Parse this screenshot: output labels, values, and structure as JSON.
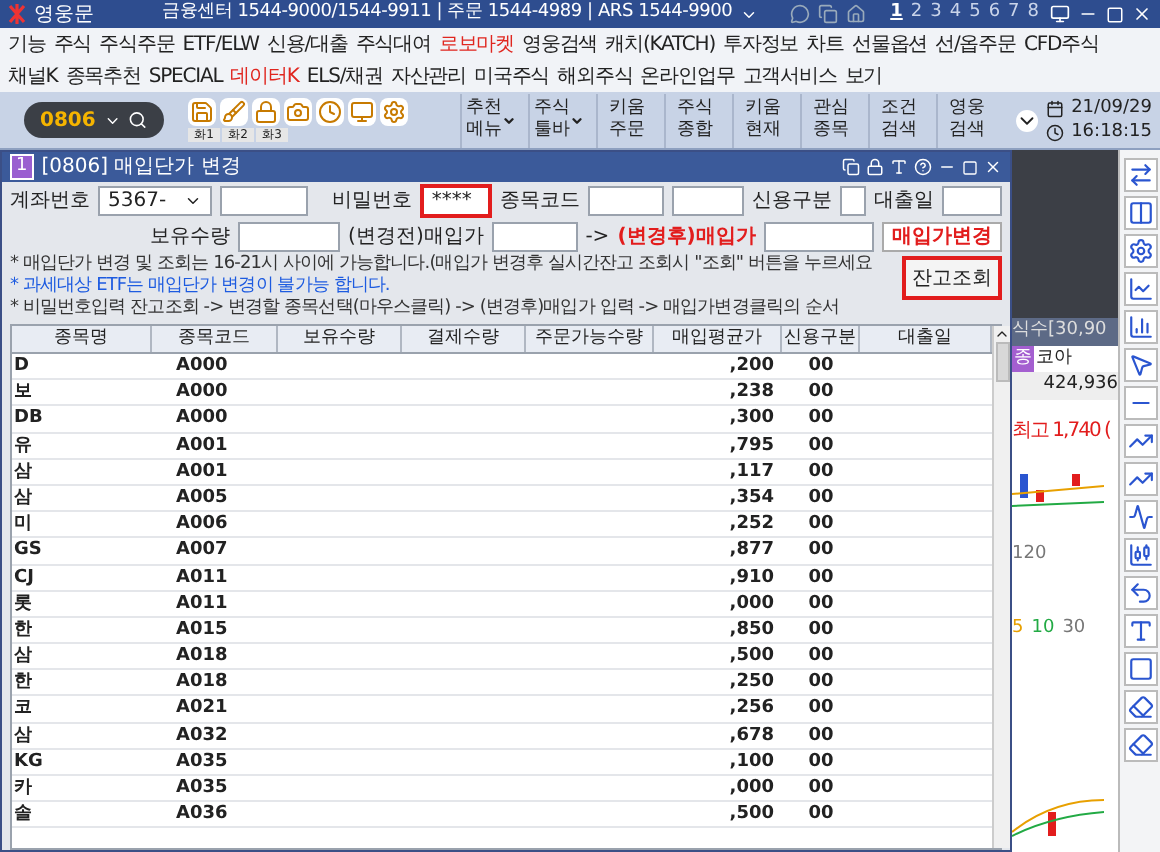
{
  "app": {
    "title": "영웅문",
    "contact": "금융센터 1544-9000/1544-9911 | 주문 1544-4989 | ARS 1544-9900",
    "pages": [
      {
        "label": "1",
        "selected": true
      },
      {
        "label": "2",
        "selected": false
      },
      {
        "label": "3",
        "selected": false
      },
      {
        "label": "4",
        "selected": false
      },
      {
        "label": "5",
        "selected": false
      },
      {
        "label": "6",
        "selected": false
      },
      {
        "label": "7",
        "selected": false
      },
      {
        "label": "8",
        "selected": false
      }
    ]
  },
  "menu_rows": [
    [
      {
        "label": "기능",
        "highlight": false
      },
      {
        "label": "주식",
        "highlight": false
      },
      {
        "label": "주식주문",
        "highlight": false
      },
      {
        "label": "ETF/ELW",
        "highlight": false
      },
      {
        "label": "신용/대출",
        "highlight": false
      },
      {
        "label": "주식대여",
        "highlight": false
      },
      {
        "label": "로보마켓",
        "highlight": true
      },
      {
        "label": "영웅검색",
        "highlight": false
      },
      {
        "label": "캐치(KATCH)",
        "highlight": false
      },
      {
        "label": "투자정보",
        "highlight": false
      },
      {
        "label": "차트",
        "highlight": false
      },
      {
        "label": "선물옵션",
        "highlight": false
      },
      {
        "label": "선/옵주문",
        "highlight": false
      },
      {
        "label": "CFD주식",
        "highlight": false
      }
    ],
    [
      {
        "label": "채널K",
        "highlight": false
      },
      {
        "label": "종목추천",
        "highlight": false
      },
      {
        "label": "SPECIAL",
        "highlight": false
      },
      {
        "label": "데이터K",
        "highlight": true
      },
      {
        "label": "ELS/채권",
        "highlight": false
      },
      {
        "label": "자산관리",
        "highlight": false
      },
      {
        "label": "미국주식",
        "highlight": false
      },
      {
        "label": "해외주식",
        "highlight": false
      },
      {
        "label": "온라인업무",
        "highlight": false
      },
      {
        "label": "고객서비스",
        "highlight": false
      },
      {
        "label": "보기",
        "highlight": false
      }
    ]
  ],
  "toolbar": {
    "screen_number": "0806",
    "slots": [
      "화1",
      "화2",
      "화3"
    ],
    "buttons": [
      {
        "lines": [
          "추천",
          "메뉴"
        ],
        "has_menu": true
      },
      {
        "lines": [
          "주식",
          "툴바"
        ],
        "has_menu": true
      },
      {
        "lines": [
          "키움",
          "주문"
        ],
        "has_menu": false
      },
      {
        "lines": [
          "주식",
          "종합"
        ],
        "has_menu": false
      },
      {
        "lines": [
          "키움",
          "현재"
        ],
        "has_menu": false
      },
      {
        "lines": [
          "관심",
          "종목"
        ],
        "has_menu": false
      },
      {
        "lines": [
          "조건",
          "검색"
        ],
        "has_menu": false
      },
      {
        "lines": [
          "영웅",
          "검색"
        ],
        "has_menu": false
      }
    ],
    "date": "21/09/29",
    "time": "16:18:15"
  },
  "dialog": {
    "number": "1",
    "title": "[0806] 매입단가 변경",
    "form": {
      "account_label": "계좌번호",
      "account": "5367-",
      "password_label": "비밀번호",
      "password": "****",
      "code_label": "종목코드",
      "credit_label": "신용구분",
      "loan_label": "대출일",
      "holding_label": "보유수량",
      "before_label": "(변경전)매입가",
      "arrow": "->",
      "after_label": "(변경후)매입가",
      "change_button": "매입가변경",
      "balance_button": "잔고조회"
    },
    "notes": [
      {
        "text": "* 매입단가 변경 및 조회는 16-21시 사이에 가능합니다.(매입가 변경후 실시간잔고 조회시 \"조회\" 버튼을 누르세요",
        "kind": "plain"
      },
      {
        "text": "* 과세대상 ETF는 매입단가 변경이 불가능 합니다.",
        "kind": "warning"
      },
      {
        "text": "* 비밀번호입력 잔고조회 -> 변경할 종목선택(마우스클릭) -> (변경후)매입가 입력 -> 매입가변경클릭의 순서",
        "kind": "plain"
      }
    ],
    "table": {
      "columns": [
        "종목명",
        "종목코드",
        "보유수량",
        "결제수량",
        "주문가능수량",
        "매입평균가",
        "신용구분",
        "대출일"
      ],
      "rows": [
        {
          "name": "D",
          "code": "A000",
          "avg_price": ",200",
          "credit": "00"
        },
        {
          "name": "보",
          "code": "A000",
          "avg_price": ",238",
          "credit": "00"
        },
        {
          "name": "DB",
          "code": "A000",
          "avg_price": ",300",
          "credit": "00"
        },
        {
          "name": "유",
          "code": "A001",
          "avg_price": ",795",
          "credit": "00"
        },
        {
          "name": "삼",
          "code": "A001",
          "avg_price": ",117",
          "credit": "00"
        },
        {
          "name": "삼",
          "code": "A005",
          "avg_price": ",354",
          "credit": "00"
        },
        {
          "name": "미",
          "code": "A006",
          "avg_price": ",252",
          "credit": "00"
        },
        {
          "name": "GS",
          "code": "A007",
          "avg_price": ",877",
          "credit": "00"
        },
        {
          "name": "CJ",
          "code": "A011",
          "avg_price": ",910",
          "credit": "00"
        },
        {
          "name": "롯",
          "code": "A011",
          "avg_price": ",000",
          "credit": "00"
        },
        {
          "name": "한",
          "code": "A015",
          "avg_price": ",850",
          "credit": "00"
        },
        {
          "name": "삼",
          "code": "A018",
          "avg_price": ",500",
          "credit": "00"
        },
        {
          "name": "한",
          "code": "A018",
          "avg_price": ",250",
          "credit": "00"
        },
        {
          "name": "코",
          "code": "A021",
          "avg_price": ",256",
          "credit": "00"
        },
        {
          "name": "삼",
          "code": "A032",
          "avg_price": ",678",
          "credit": "00"
        },
        {
          "name": "KG",
          "code": "A035",
          "avg_price": ",100",
          "credit": "00"
        },
        {
          "name": "카",
          "code": "A035",
          "avg_price": ",000",
          "credit": "00"
        },
        {
          "name": "솔",
          "code": "A036",
          "avg_price": ",500",
          "credit": "00"
        }
      ]
    }
  },
  "chart_window": {
    "title": "식수[30,90",
    "badge": "종",
    "stock": "코아",
    "value": "424,936",
    "high": "최고 1,740 (",
    "period": "120",
    "ma": [
      {
        "label": "5",
        "color": "#e8a000"
      },
      {
        "label": "10",
        "color": "#22aa44"
      },
      {
        "label": "30",
        "color": "#777777"
      }
    ]
  }
}
